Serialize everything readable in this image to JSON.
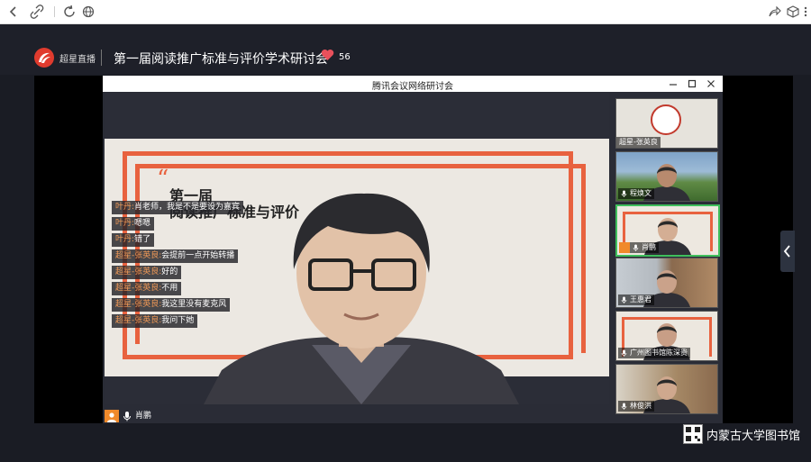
{
  "browser": {
    "icons": [
      "back-icon",
      "link-icon",
      "reload-icon",
      "globe-icon",
      "share-icon",
      "cube-icon",
      "menu-icon"
    ]
  },
  "header": {
    "brand": "超星直播",
    "title": "第一届阅读推广标准与评价学术研讨会",
    "likes": "56",
    "heart_color": "#e8505b",
    "logo_color": "#e03b2e"
  },
  "meeting": {
    "window_title": "腾讯会议网络研讨会",
    "slide": {
      "quote_mark": "“",
      "line1": "第一届",
      "line2": "阅读推广标准与评价"
    },
    "chat": [
      {
        "name": "叶丹:",
        "text": "肖老师，我是不是要设为嘉宾"
      },
      {
        "name": "叶丹:",
        "text": "嗯嗯"
      },
      {
        "name": "叶丹:",
        "text": "错了"
      },
      {
        "name": "超星-张英良:",
        "text": "会提前一点开始转播"
      },
      {
        "name": "超星-张英良:",
        "text": "好的"
      },
      {
        "name": "超星-张英良:",
        "text": "不用"
      },
      {
        "name": "超星-张英良:",
        "text": "我这里没有麦克风"
      },
      {
        "name": "超星-张英良:",
        "text": "我问下她"
      }
    ],
    "active_speaker": "肖鹏",
    "participants": [
      {
        "name": "超星-张英良"
      },
      {
        "name": "程焕文"
      },
      {
        "name": "肖鹏"
      },
      {
        "name": "王惠君"
      },
      {
        "name": "广州图书馆陈深贵"
      },
      {
        "name": "林俊洪"
      }
    ],
    "accent_color": "#e8623f",
    "active_border_color": "#3fbf5c"
  },
  "footer": {
    "text": "内蒙古大学图书馆"
  }
}
